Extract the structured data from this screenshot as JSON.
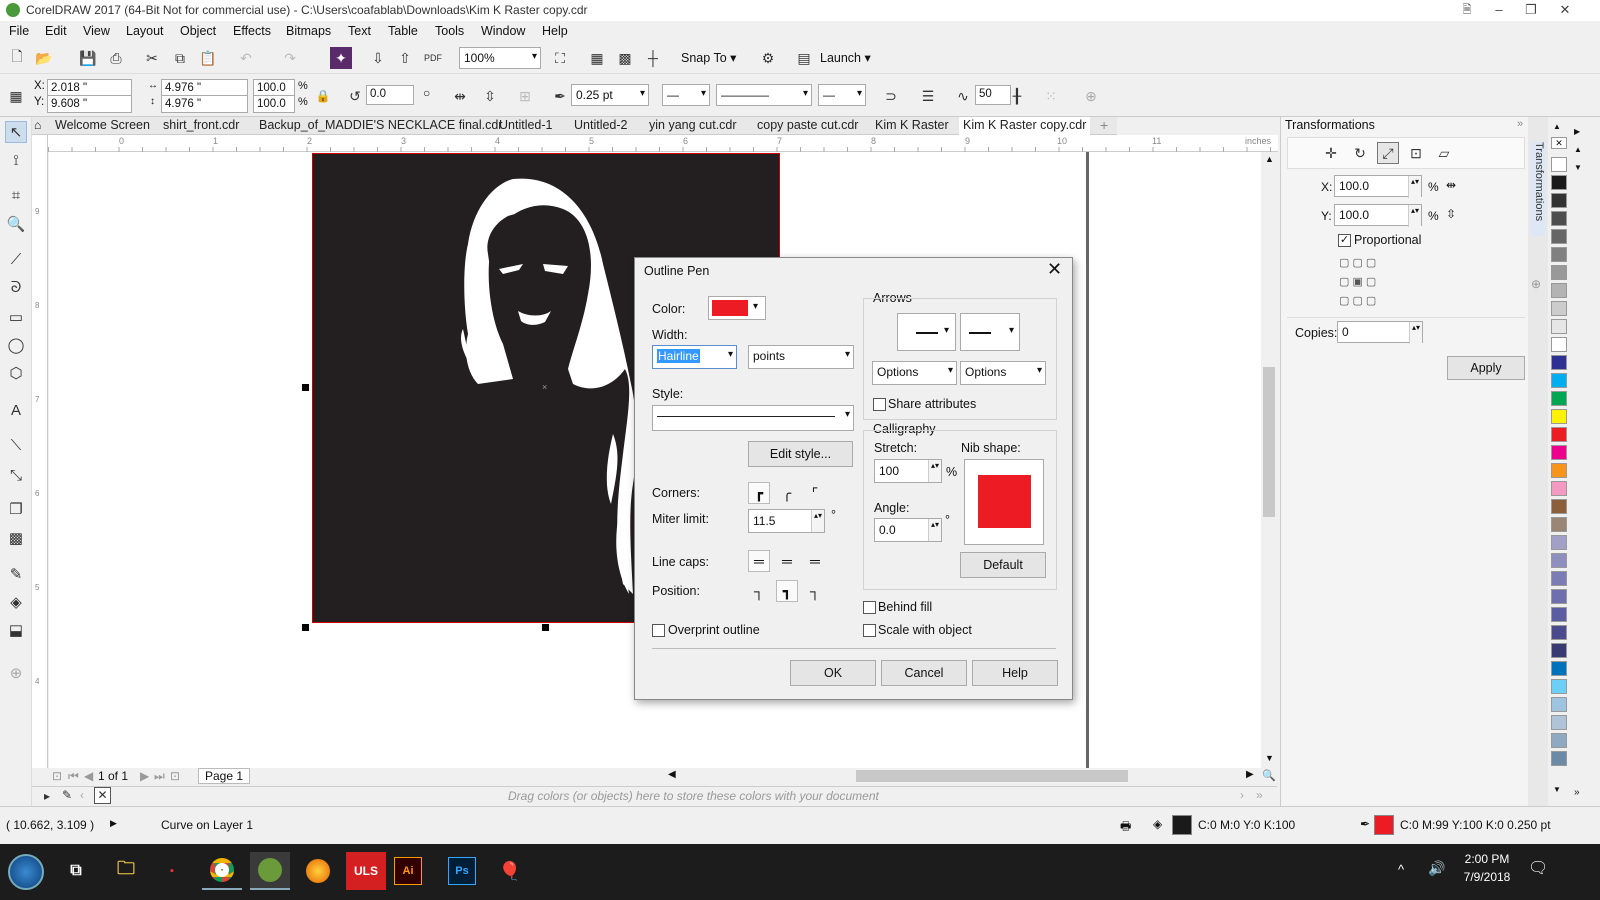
{
  "window": {
    "title": "CorelDRAW 2017 (64-Bit Not for commercial use) - C:\\Users\\coafablab\\Downloads\\Kim K Raster copy.cdr",
    "minimize": "–",
    "restore": "❐",
    "close": "✕"
  },
  "menu": [
    "File",
    "Edit",
    "View",
    "Layout",
    "Object",
    "Effects",
    "Bitmaps",
    "Text",
    "Table",
    "Tools",
    "Window",
    "Help"
  ],
  "toolbar1": {
    "zoom": "100%",
    "snap_to": "Snap To",
    "launch": "Launch"
  },
  "propbar": {
    "x_label": "X:",
    "x_value": "2.018 \"",
    "y_label": "Y:",
    "y_value": "9.608 \"",
    "width_value": "4.976 \"",
    "height_value": "4.976 \"",
    "scale_w": "100.0",
    "scale_h": "100.0",
    "pct": "%",
    "rotation": "0.0",
    "outline_width": "0.25 pt",
    "smoothing": "50"
  },
  "tabs": [
    "Welcome Screen",
    "shirt_front.cdr",
    "Backup_of_MADDIE'S NECKLACE final.cdr",
    "Untitled-1",
    "Untitled-2",
    "yin yang cut.cdr",
    "copy paste cut.cdr",
    "Kim K Raster",
    "Kim K Raster copy.cdr"
  ],
  "ruler": {
    "ticks": [
      "0",
      "1",
      "2",
      "3",
      "4",
      "5",
      "6",
      "7",
      "8",
      "9",
      "10",
      "11"
    ],
    "unit": "inches",
    "v_ticks": [
      "9",
      "8",
      "7",
      "6",
      "5",
      "4"
    ]
  },
  "pagenav": {
    "page_of": "1  of  1",
    "page_label": "Page 1"
  },
  "docpalette": {
    "hint": "Drag colors (or objects) here to store these colors with your document"
  },
  "status": {
    "coords": "( 10.662, 3.109 )",
    "object": "Curve on Layer 1",
    "fill_info": "C:0 M:0 Y:0 K:100",
    "outline_info": "C:0 M:99 Y:100 K:0  0.250 pt"
  },
  "taskbar": {
    "time": "2:00 PM",
    "date": "7/9/2018"
  },
  "docker": {
    "title": "Transformations",
    "vertical_tab": "Transformations",
    "x_label": "X:",
    "x_value": "100.0",
    "y_label": "Y:",
    "y_value": "100.0",
    "pct": "%",
    "proportional": "Proportional",
    "copies_label": "Copies:",
    "copies_value": "0",
    "apply": "Apply"
  },
  "dialog": {
    "title": "Outline Pen",
    "color_label": "Color:",
    "width_label": "Width:",
    "width_value": "Hairline",
    "units_value": "points",
    "style_label": "Style:",
    "edit_style": "Edit style...",
    "corners_label": "Corners:",
    "miter_label": "Miter limit:",
    "miter_value": "11.5",
    "degree": "°",
    "linecaps_label": "Line caps:",
    "position_label": "Position:",
    "overprint": "Overprint outline",
    "arrows_label": "Arrows",
    "options1": "Options",
    "options2": "Options",
    "share": "Share attributes",
    "calligraphy_label": "Calligraphy",
    "stretch_label": "Stretch:",
    "stretch_value": "100",
    "pct": "%",
    "nib_label": "Nib shape:",
    "angle_label": "Angle:",
    "angle_value": "0.0",
    "default": "Default",
    "behind_fill": "Behind fill",
    "scale_with": "Scale with object",
    "ok": "OK",
    "cancel": "Cancel",
    "help": "Help"
  },
  "colors": {
    "outline_red": "#ed1c24",
    "artwork_bg": "#231f20",
    "selection_blue": "#3399ff"
  },
  "palette_colors": [
    "#ffffff",
    "#1a1a1a",
    "#333333",
    "#4d4d4d",
    "#666666",
    "#808080",
    "#999999",
    "#b3b3b3",
    "#cccccc",
    "#e6e6e6",
    "#ffffff",
    "#2e3192",
    "#00aeef",
    "#00a651",
    "#fff200",
    "#ed1c24",
    "#ec008c",
    "#f7941d",
    "#f49ac1",
    "#8b5e3c",
    "#998675",
    "#a3a0c8",
    "#8f8fbf",
    "#7b7bb5",
    "#6f6fae",
    "#5c5ca3",
    "#4a4a8c",
    "#3a3a73",
    "#0072bc",
    "#6dcff6",
    "#9fc4e0",
    "#b0c4d8",
    "#8ea9c0",
    "#6b8aa5"
  ]
}
